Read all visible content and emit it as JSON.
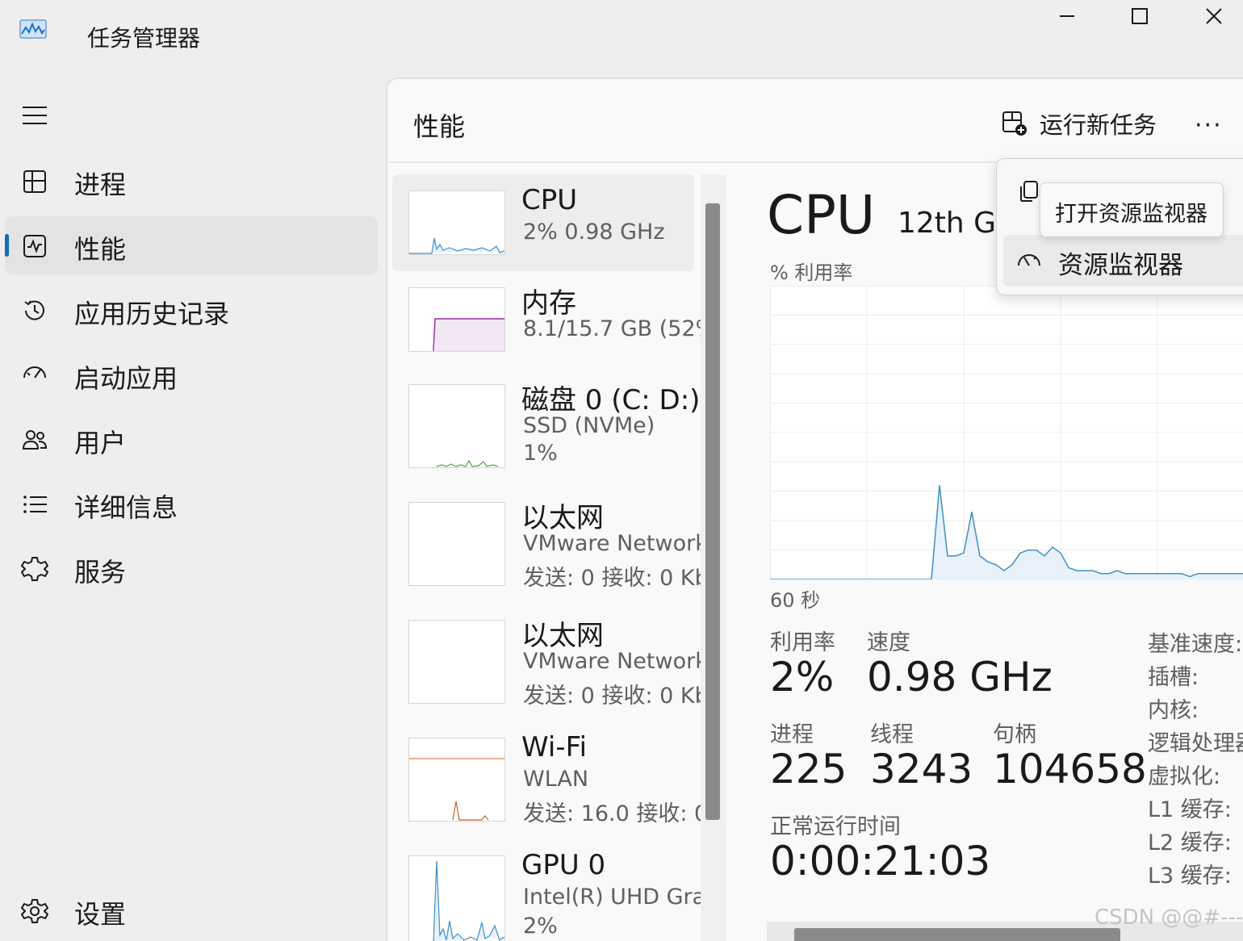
{
  "app": {
    "title": "任务管理器"
  },
  "window_controls": {
    "minimize_icon": "minimize-icon",
    "maximize_icon": "maximize-icon",
    "close_icon": "close-icon"
  },
  "nav": {
    "items": [
      {
        "label": "进程",
        "icon": "processes-icon"
      },
      {
        "label": "性能",
        "icon": "performance-icon",
        "active": true
      },
      {
        "label": "应用历史记录",
        "icon": "history-icon"
      },
      {
        "label": "启动应用",
        "icon": "startup-icon"
      },
      {
        "label": "用户",
        "icon": "users-icon"
      },
      {
        "label": "详细信息",
        "icon": "details-icon"
      },
      {
        "label": "服务",
        "icon": "services-icon"
      }
    ],
    "settings": {
      "label": "设置",
      "icon": "gear-icon"
    }
  },
  "header": {
    "title": "性能",
    "run_task": "运行新任务",
    "more": "···"
  },
  "resources": [
    {
      "name": "CPU",
      "lines": [
        "2% 0.98 GHz"
      ]
    },
    {
      "name": "内存",
      "lines": [
        "8.1/15.7 GB (52%)"
      ]
    },
    {
      "name": "磁盘 0 (C: D:)",
      "lines": [
        "SSD (NVMe)",
        "1%"
      ]
    },
    {
      "name": "以太网",
      "lines": [
        "VMware Network",
        "发送: 0 接收: 0 Kb"
      ]
    },
    {
      "name": "以太网",
      "lines": [
        "VMware Network",
        "发送: 0 接收: 0 Kb"
      ]
    },
    {
      "name": "Wi-Fi",
      "lines": [
        "WLAN",
        "发送: 16.0 接收: 0"
      ]
    },
    {
      "name": "GPU 0",
      "lines": [
        "Intel(R) UHD Gra",
        "2%"
      ]
    }
  ],
  "detail": {
    "title": "CPU",
    "subtitle": "12th Ge",
    "util_label": "% 利用率",
    "time_label": "60 秒",
    "stats": {
      "utilization": {
        "label": "利用率",
        "value": "2%"
      },
      "speed": {
        "label": "速度",
        "value": "0.98 GHz"
      },
      "processes": {
        "label": "进程",
        "value": "225"
      },
      "threads": {
        "label": "线程",
        "value": "3243"
      },
      "handles": {
        "label": "句柄",
        "value": "104658"
      },
      "uptime": {
        "label": "正常运行时间",
        "value": "0:00:21:03"
      }
    },
    "specs": [
      "基准速度:",
      "插槽:",
      "内核:",
      "逻辑处理器",
      "虚拟化:",
      "L1 缓存:",
      "L2 缓存:",
      "L3 缓存:"
    ]
  },
  "chart_data": {
    "type": "area",
    "title": "",
    "ylabel": "% 利用率",
    "xlabel": "60 秒",
    "ylim": [
      0,
      100
    ],
    "x": [
      0,
      1,
      2,
      3,
      4,
      5,
      6,
      7,
      8,
      9,
      10,
      11,
      12,
      13,
      14,
      15,
      16,
      17,
      18,
      19,
      20,
      21,
      22,
      23,
      24,
      25,
      26,
      27,
      28,
      29,
      30,
      31,
      32,
      33,
      34,
      35,
      36,
      37,
      38,
      39,
      40,
      41,
      42,
      43,
      44,
      45,
      46,
      47,
      48,
      49,
      50,
      51,
      52,
      53,
      54,
      55,
      56,
      57,
      58,
      59,
      60
    ],
    "series": [
      {
        "values": [
          0,
          0,
          0,
          0,
          0,
          0,
          0,
          0,
          0,
          0,
          0,
          0,
          0,
          0,
          0,
          0,
          0,
          0,
          0,
          0,
          0,
          32,
          8,
          8,
          9,
          23,
          8,
          6,
          5,
          3,
          5,
          9,
          10,
          10,
          8,
          11,
          9,
          4,
          3,
          3,
          3,
          2,
          2,
          3,
          2,
          2,
          2,
          2,
          2,
          2,
          2,
          2,
          1,
          2,
          2,
          2,
          2,
          2,
          2,
          2,
          17
        ]
      }
    ],
    "grid": true,
    "line_color": "#3e8fc9",
    "fill_color": "#e8f1f9"
  },
  "context_menu": {
    "items": [
      {
        "label": "复制",
        "icon": "copy-icon"
      },
      {
        "label": "资源监视器",
        "icon": "resource-monitor-icon"
      }
    ],
    "tooltip": "打开资源监视器"
  },
  "watermark": "CSDN @@#---"
}
